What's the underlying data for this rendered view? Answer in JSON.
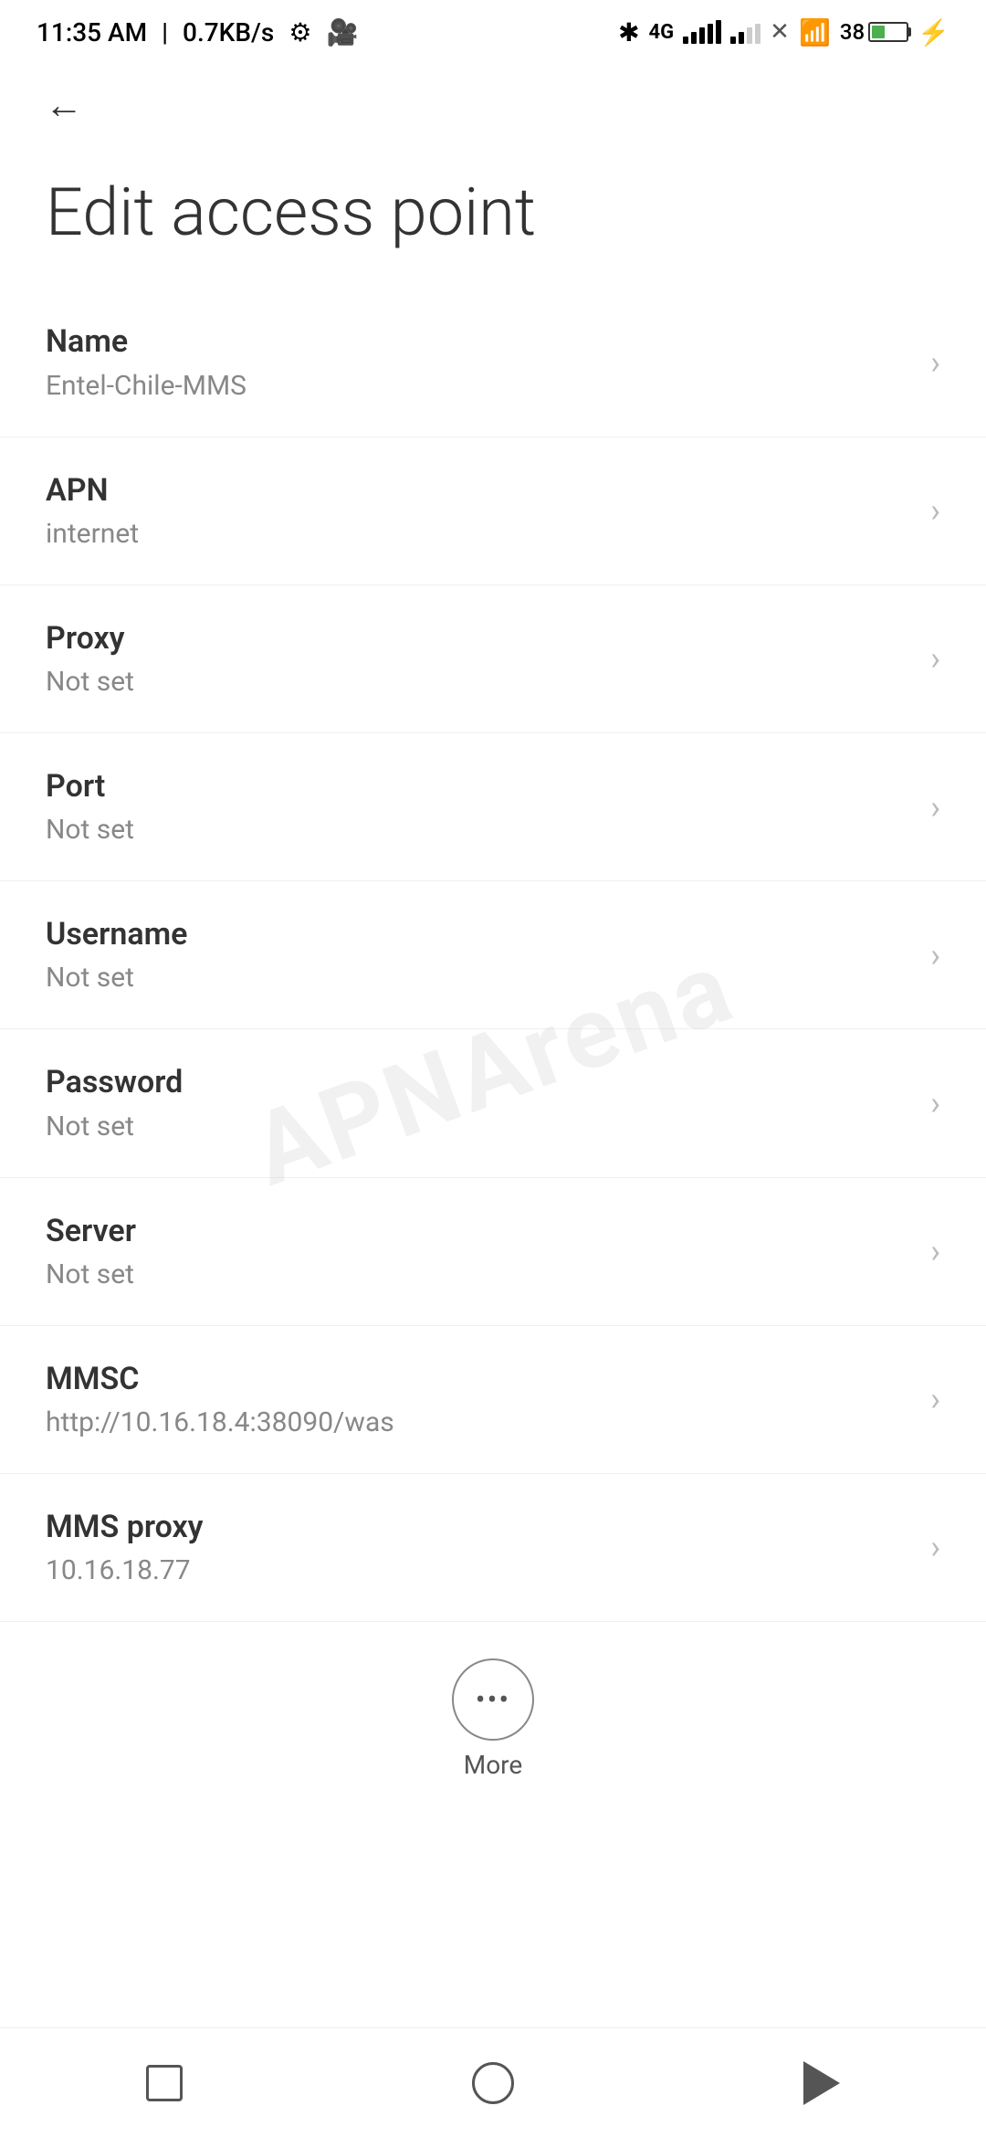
{
  "statusBar": {
    "time": "11:35 AM",
    "speed": "0.7KB/s",
    "batteryPercent": "38"
  },
  "page": {
    "title": "Edit access point",
    "backButtonLabel": "Back"
  },
  "settings": {
    "items": [
      {
        "id": "name",
        "label": "Name",
        "value": "Entel-Chile-MMS"
      },
      {
        "id": "apn",
        "label": "APN",
        "value": "internet"
      },
      {
        "id": "proxy",
        "label": "Proxy",
        "value": "Not set"
      },
      {
        "id": "port",
        "label": "Port",
        "value": "Not set"
      },
      {
        "id": "username",
        "label": "Username",
        "value": "Not set"
      },
      {
        "id": "password",
        "label": "Password",
        "value": "Not set"
      },
      {
        "id": "server",
        "label": "Server",
        "value": "Not set"
      },
      {
        "id": "mmsc",
        "label": "MMSC",
        "value": "http://10.16.18.4:38090/was"
      },
      {
        "id": "mms-proxy",
        "label": "MMS proxy",
        "value": "10.16.18.77"
      }
    ]
  },
  "more": {
    "label": "More"
  },
  "watermark": "APNArena"
}
